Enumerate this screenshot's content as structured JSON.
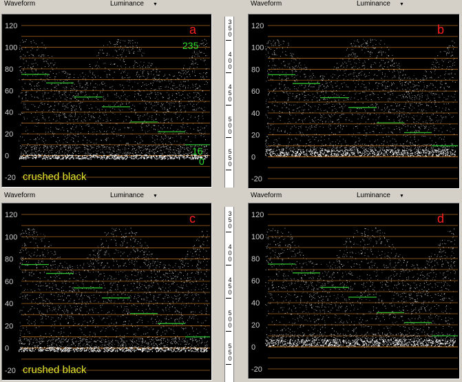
{
  "panels": [
    {
      "id": "a",
      "header": {
        "title": "Waveform",
        "mode": "Luminance",
        "arrow": "▼"
      },
      "corner_label": "a",
      "level_labels": [
        "235",
        "16",
        "0"
      ],
      "overlay_text": "crushed black",
      "variant": "crushed"
    },
    {
      "id": "b",
      "header": {
        "title": "Waveform",
        "mode": "Luminance",
        "arrow": "▼"
      },
      "corner_label": "b",
      "level_labels": [],
      "overlay_text": "",
      "variant": "normal"
    },
    {
      "id": "c",
      "header": {
        "title": "Waveform",
        "mode": "Luminance",
        "arrow": "▼"
      },
      "corner_label": "c",
      "level_labels": [],
      "overlay_text": "crushed black",
      "variant": "crushed"
    },
    {
      "id": "d",
      "header": {
        "title": "Waveform",
        "mode": "Luminance",
        "arrow": "▼"
      },
      "corner_label": "d",
      "level_labels": [],
      "overlay_text": "",
      "variant": "normal"
    }
  ],
  "y_axis_ticks": [
    "120",
    "100",
    "80",
    "60",
    "40",
    "20",
    "0",
    "-20"
  ],
  "ruler_top": [
    "3\n5\n0",
    "4\n0\n0",
    "4\n5\n0",
    "5\n0\n0",
    "5\n5\n0"
  ],
  "ruler_bottom": [
    "3\n5\n0",
    "4\n0\n0",
    "4\n5\n0",
    "5\n0\n0",
    "5\n5\n0"
  ],
  "colors": {
    "gridline": "#c87820",
    "axis_label": "#cfcfcf",
    "corner_label": "#ff2020",
    "level_label": "#30e030",
    "overlay_text": "#e8e830",
    "step_line": "#30c030"
  }
}
